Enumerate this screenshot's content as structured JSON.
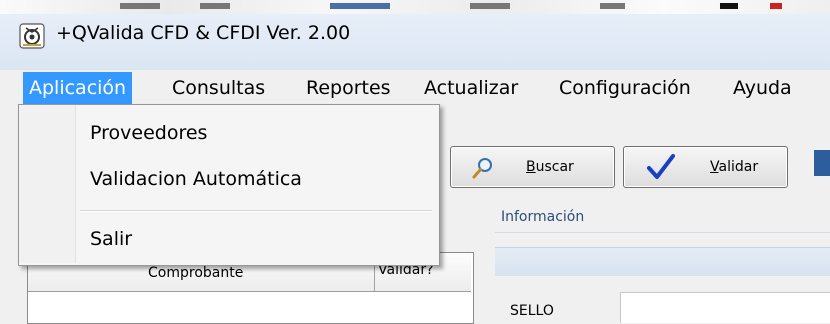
{
  "window": {
    "title": "+QValida CFD & CFDI Ver. 2.00",
    "icon": "app-logo-icon"
  },
  "menubar": {
    "items": [
      {
        "label": "Aplicación",
        "active": true
      },
      {
        "label": "Consultas"
      },
      {
        "label": "Reportes"
      },
      {
        "label": "Actualizar"
      },
      {
        "label": "Configuración"
      },
      {
        "label": "Ayuda"
      }
    ]
  },
  "dropdown": {
    "items": [
      {
        "label": "Proveedores"
      },
      {
        "label": "Validacion Automática"
      },
      {
        "label": "Salir"
      }
    ]
  },
  "toolbar": {
    "buscar": {
      "accesskey": "B",
      "rest": "uscar",
      "icon": "magnifier-icon"
    },
    "validar": {
      "accesskey": "V",
      "rest": "alidar",
      "icon": "checkmark-icon"
    }
  },
  "info": {
    "section_label": "Información",
    "sello_label": "SELLO"
  },
  "grid": {
    "columns": [
      "Comprobante",
      "Validar?"
    ]
  },
  "colors": {
    "menu_highlight": "#3399ff",
    "accent_blue": "#2e5d9e"
  }
}
